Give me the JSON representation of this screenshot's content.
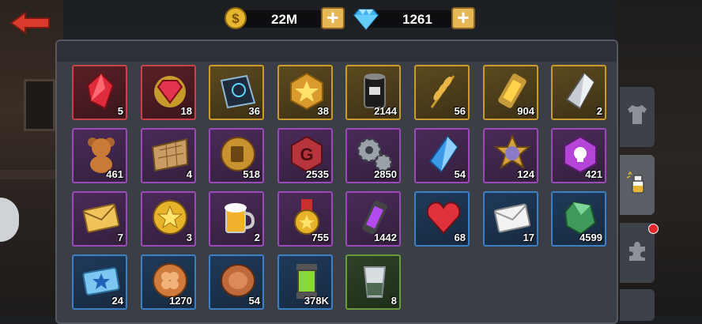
{
  "header": {
    "coins": {
      "value": "22M",
      "icon": "gold-coin-icon"
    },
    "gems": {
      "value": "1261",
      "icon": "blue-diamond-icon"
    }
  },
  "inventory": [
    {
      "name": "red-crystal",
      "count": "5",
      "rarity": "red"
    },
    {
      "name": "ruby-emblem",
      "count": "18",
      "rarity": "red"
    },
    {
      "name": "blueprint-tablet",
      "count": "36",
      "rarity": "gold"
    },
    {
      "name": "star-medal",
      "count": "38",
      "rarity": "gold"
    },
    {
      "name": "oil-barrel",
      "count": "2144",
      "rarity": "gold"
    },
    {
      "name": "wheat",
      "count": "56",
      "rarity": "gold"
    },
    {
      "name": "energy-capsule",
      "count": "904",
      "rarity": "gold"
    },
    {
      "name": "silver-crystal",
      "count": "2",
      "rarity": "gold"
    },
    {
      "name": "teddy-bear",
      "count": "461",
      "rarity": "purple"
    },
    {
      "name": "map-scroll",
      "count": "4",
      "rarity": "purple"
    },
    {
      "name": "beer-coin",
      "count": "518",
      "rarity": "purple"
    },
    {
      "name": "g-token",
      "count": "2535",
      "rarity": "purple"
    },
    {
      "name": "gears",
      "count": "2850",
      "rarity": "purple"
    },
    {
      "name": "blue-crystal",
      "count": "54",
      "rarity": "purple"
    },
    {
      "name": "rank-badge",
      "count": "124",
      "rarity": "purple"
    },
    {
      "name": "skull-gem",
      "count": "421",
      "rarity": "purple"
    },
    {
      "name": "gold-envelope",
      "count": "7",
      "rarity": "purple"
    },
    {
      "name": "star-coin",
      "count": "3",
      "rarity": "purple"
    },
    {
      "name": "beer-mug",
      "count": "2",
      "rarity": "purple"
    },
    {
      "name": "gold-medal",
      "count": "755",
      "rarity": "purple"
    },
    {
      "name": "purple-capsule",
      "count": "1442",
      "rarity": "purple"
    },
    {
      "name": "heart",
      "count": "68",
      "rarity": "blue"
    },
    {
      "name": "white-envelope",
      "count": "17",
      "rarity": "blue"
    },
    {
      "name": "green-gem",
      "count": "4599",
      "rarity": "blue"
    },
    {
      "name": "star-ticket",
      "count": "24",
      "rarity": "blue"
    },
    {
      "name": "clover-coin",
      "count": "1270",
      "rarity": "blue"
    },
    {
      "name": "copper-coin",
      "count": "54",
      "rarity": "blue"
    },
    {
      "name": "green-capsule",
      "count": "378K",
      "rarity": "blue"
    },
    {
      "name": "shot-glass",
      "count": "8",
      "rarity": "green"
    }
  ],
  "side_tabs": [
    {
      "name": "shirt-icon"
    },
    {
      "name": "potion-icon",
      "active": true
    },
    {
      "name": "puzzle-icon",
      "notification": true
    }
  ]
}
